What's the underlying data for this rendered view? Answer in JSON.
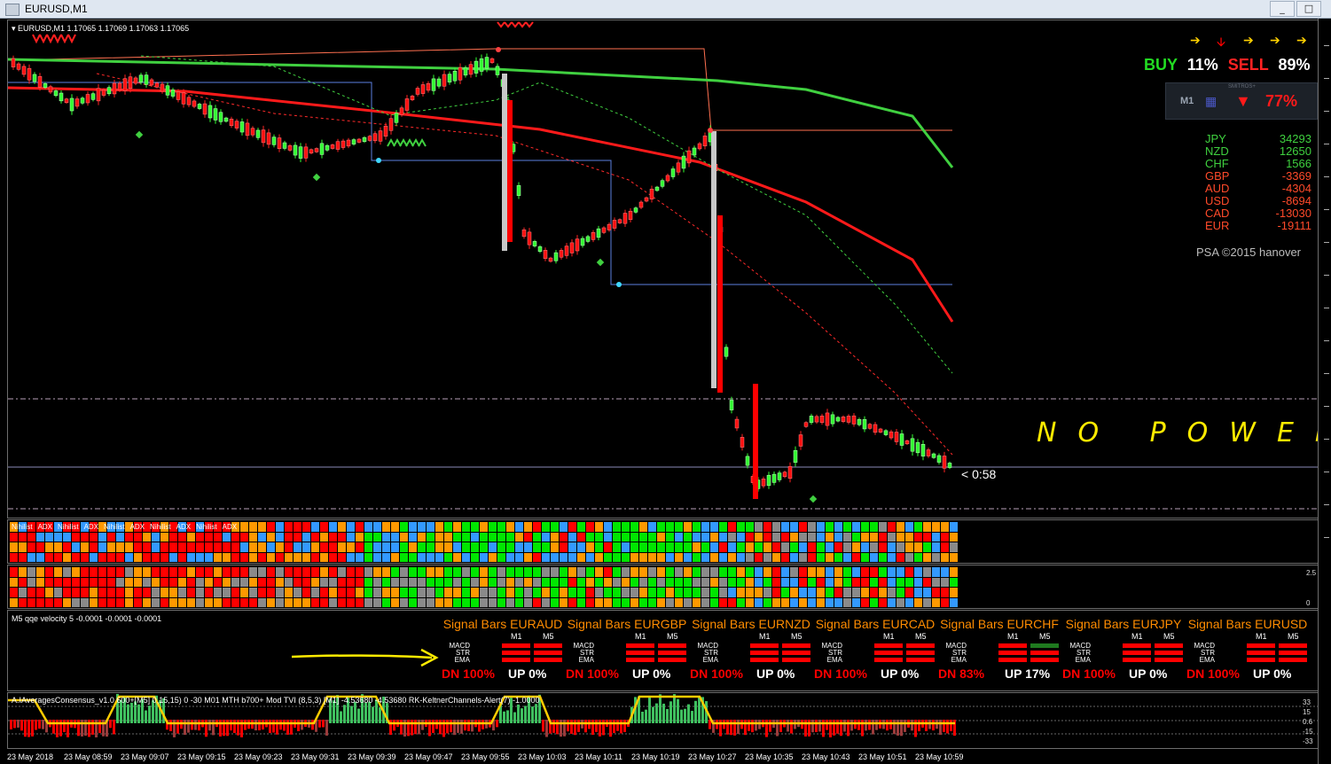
{
  "window": {
    "title": "EURUSD,M1"
  },
  "chart": {
    "header": "EURUSD,M1  1.17065 1.17069 1.17063 1.17065",
    "countdown": "< 0:58",
    "annotation": "NO POWER",
    "copyright": "PSA ©2015 hanover"
  },
  "buysell": {
    "buy_label": "BUY",
    "buy_pct": "11%",
    "sell_label": "SELL",
    "sell_pct": "89%",
    "arrows": [
      "right",
      "down",
      "right",
      "right",
      "right"
    ],
    "meter_tf": "M1",
    "meter_pct": "77%",
    "meter_label": "SMITROS+"
  },
  "currencies": [
    {
      "name": "JPY",
      "value": "34293",
      "color": "#3fd13f"
    },
    {
      "name": "NZD",
      "value": "12650",
      "color": "#3fd13f"
    },
    {
      "name": "CHF",
      "value": "1566",
      "color": "#3fd13f"
    },
    {
      "name": "GBP",
      "value": "-3369",
      "color": "#ff4a2a"
    },
    {
      "name": "AUD",
      "value": "-4304",
      "color": "#ff4a2a"
    },
    {
      "name": "USD",
      "value": "-8694",
      "color": "#ff4a2a"
    },
    {
      "name": "CAD",
      "value": "-13030",
      "color": "#ff4a2a"
    },
    {
      "name": "EUR",
      "value": "-19111",
      "color": "#ff4a2a"
    }
  ],
  "ind1_labels": [
    "Nihilist",
    "ADX",
    "Nihilist",
    "ADX",
    "Nihilist",
    "ADX",
    "Nihilist",
    "ADX",
    "Nihilist",
    "ADX"
  ],
  "qqe": {
    "label": "M5  qqe velocity 5 -0.0001 -0.0001 -0.0001"
  },
  "signal_bars": [
    {
      "title": "Signal Bars EURAUD",
      "dn": "DN 100%",
      "up": "UP 0%",
      "m5_str": "red"
    },
    {
      "title": "Signal Bars EURGBP",
      "dn": "DN 100%",
      "up": "UP 0%",
      "m5_str": "red"
    },
    {
      "title": "Signal Bars EURNZD",
      "dn": "DN 100%",
      "up": "UP 0%",
      "m5_str": "red"
    },
    {
      "title": "Signal Bars EURCAD",
      "dn": "DN 100%",
      "up": "UP 0%",
      "m5_str": "red"
    },
    {
      "title": "Signal Bars EURCHF",
      "dn": "DN 83%",
      "up": "UP 17%",
      "m5_str": "green"
    },
    {
      "title": "Signal Bars EURJPY",
      "dn": "DN 100%",
      "up": "UP 0%",
      "m5_str": "red"
    },
    {
      "title": "Signal Bars EURUSD",
      "dn": "DN 100%",
      "up": "UP 0%",
      "m5_str": "red"
    }
  ],
  "signal_labels": {
    "m1": "M1",
    "m5": "M5",
    "macd": "MACD",
    "str": "STR",
    "ema": "EMA"
  },
  "bottom_indicator": {
    "label": "A.IAveragesConsensus_v1.0 600+[M5] 0,15,15) 0 -30  M01 MTH b700+ Mod TVI (8,5,3) [M1] -4.53680 -4.53680  RK-KeltnerChannels-Alert(7) -1.0000"
  },
  "time_axis": [
    "23 May 2018",
    "23 May 08:59",
    "23 May 09:07",
    "23 May 09:15",
    "23 May 09:23",
    "23 May 09:31",
    "23 May 09:39",
    "23 May 09:47",
    "23 May 09:55",
    "23 May 10:03",
    "23 May 10:11",
    "23 May 10:19",
    "23 May 10:27",
    "23 May 10:35",
    "23 May 10:43",
    "23 May 10:51",
    "23 May 10:59"
  ],
  "bottom_axis_labels": [
    "33",
    "15",
    "0.6",
    "-15",
    "-33"
  ],
  "ind2_axis_labels": [
    "2.5",
    "0"
  ],
  "colors": {
    "green": "#00e600",
    "red": "#ff0000",
    "orange": "#ff9900",
    "blue": "#3399ff",
    "gray": "#8a8a8a",
    "accent_orange": "#ff8c00"
  }
}
